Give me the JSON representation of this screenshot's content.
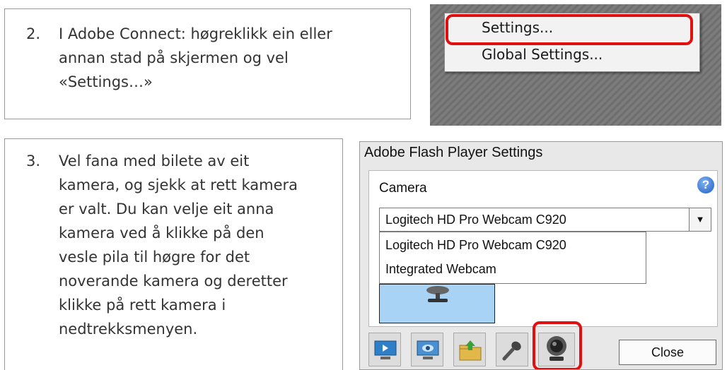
{
  "step2": {
    "number": "2.",
    "text": "I Adobe Connect: høgreklikk ein eller\nannan stad på skjermen og vel\n«Settings…»"
  },
  "step3": {
    "number": "3.",
    "text": "Vel  fana med bilete av eit\nkamera, og sjekk at rett kamera\ner valt. Du kan velje eit anna\nkamera ved å klikke på den\nvesle pila til høgre for  det\nnoverande kamera og deretter\nklikke på rett kamera i\nnedtrekksmenyen."
  },
  "context_menu": {
    "items": [
      "Settings...",
      "Global Settings..."
    ]
  },
  "flash_settings": {
    "title": "Adobe Flash Player Settings",
    "panel_label": "Camera",
    "help_icon_glyph": "?",
    "selected_camera": "Logitech HD Pro Webcam C920",
    "dropdown_arrow": "▼",
    "options": [
      "Logitech HD Pro Webcam C920",
      "Integrated Webcam"
    ],
    "tabs": [
      "privacy-icon",
      "display-icon",
      "local-storage-icon",
      "microphone-icon",
      "camera-icon"
    ],
    "close_label": "Close"
  },
  "colors": {
    "highlight": "#e01010",
    "preview_bg": "#a9d3f5",
    "dialog_bg": "#e8e8e8"
  }
}
